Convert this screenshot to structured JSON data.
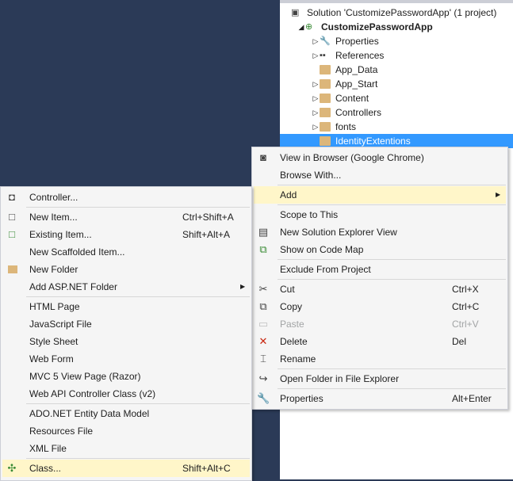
{
  "solution_explorer": {
    "rows": [
      {
        "label": "Solution 'CustomizePasswordApp' (1 project)",
        "icon": "solution-icon",
        "expander": "",
        "indent": 0,
        "bold": false
      },
      {
        "label": "CustomizePasswordApp",
        "icon": "web-project-icon",
        "expander": "expanded",
        "indent": 1,
        "bold": true
      },
      {
        "label": "Properties",
        "icon": "wrench-icon",
        "expander": "collapsed",
        "indent": 2
      },
      {
        "label": "References",
        "icon": "references-icon",
        "expander": "collapsed",
        "indent": 2
      },
      {
        "label": "App_Data",
        "icon": "folder-icon",
        "expander": "",
        "indent": 2
      },
      {
        "label": "App_Start",
        "icon": "folder-icon",
        "expander": "collapsed",
        "indent": 2
      },
      {
        "label": "Content",
        "icon": "folder-icon",
        "expander": "collapsed",
        "indent": 2
      },
      {
        "label": "Controllers",
        "icon": "folder-icon",
        "expander": "collapsed",
        "indent": 2
      },
      {
        "label": "fonts",
        "icon": "folder-icon",
        "expander": "collapsed",
        "indent": 2
      },
      {
        "label": "IdentityExtentions",
        "icon": "folder-icon",
        "expander": "",
        "indent": 2,
        "selected": true
      }
    ]
  },
  "context_menu": {
    "groups": [
      [
        {
          "label": "View in Browser (Google Chrome)",
          "icon": "view-in-browser-icon"
        },
        {
          "label": "Browse With..."
        }
      ],
      [
        {
          "label": "Add",
          "submenu": true,
          "highlighted": true
        }
      ],
      [
        {
          "label": "Scope to This"
        },
        {
          "label": "New Solution Explorer View",
          "icon": "new-view-icon"
        },
        {
          "label": "Show on Code Map",
          "icon": "code-map-icon"
        }
      ],
      [
        {
          "label": "Exclude From Project"
        }
      ],
      [
        {
          "label": "Cut",
          "icon": "cut-icon",
          "shortcut": "Ctrl+X"
        },
        {
          "label": "Copy",
          "icon": "copy-icon",
          "shortcut": "Ctrl+C"
        },
        {
          "label": "Paste",
          "icon": "paste-icon",
          "shortcut": "Ctrl+V",
          "disabled": true
        },
        {
          "label": "Delete",
          "icon": "delete-icon",
          "shortcut": "Del"
        },
        {
          "label": "Rename",
          "icon": "rename-icon"
        }
      ],
      [
        {
          "label": "Open Folder in File Explorer",
          "icon": "open-folder-icon"
        }
      ],
      [
        {
          "label": "Properties",
          "icon": "wrench-icon",
          "shortcut": "Alt+Enter"
        }
      ]
    ]
  },
  "add_submenu": {
    "groups": [
      [
        {
          "label": "Controller...",
          "icon": "controller-icon"
        }
      ],
      [
        {
          "label": "New Item...",
          "icon": "new-item-icon",
          "shortcut": "Ctrl+Shift+A"
        },
        {
          "label": "Existing Item...",
          "icon": "existing-item-icon",
          "shortcut": "Shift+Alt+A"
        },
        {
          "label": "New Scaffolded Item..."
        },
        {
          "label": "New Folder",
          "icon": "new-folder-icon"
        },
        {
          "label": "Add ASP.NET Folder",
          "submenu": true
        }
      ],
      [
        {
          "label": "HTML Page"
        },
        {
          "label": "JavaScript File"
        },
        {
          "label": "Style Sheet"
        },
        {
          "label": "Web Form"
        },
        {
          "label": "MVC 5 View Page (Razor)"
        },
        {
          "label": "Web API Controller Class (v2)"
        }
      ],
      [
        {
          "label": "ADO.NET Entity Data Model"
        },
        {
          "label": "Resources File"
        },
        {
          "label": "XML File"
        }
      ],
      [
        {
          "label": "Class...",
          "icon": "class-icon",
          "shortcut": "Shift+Alt+C",
          "highlighted": true
        }
      ]
    ]
  },
  "colors": {
    "selection": "#3399ff",
    "menu_highlight": "#fff6c9",
    "background": "#2b3a57"
  }
}
